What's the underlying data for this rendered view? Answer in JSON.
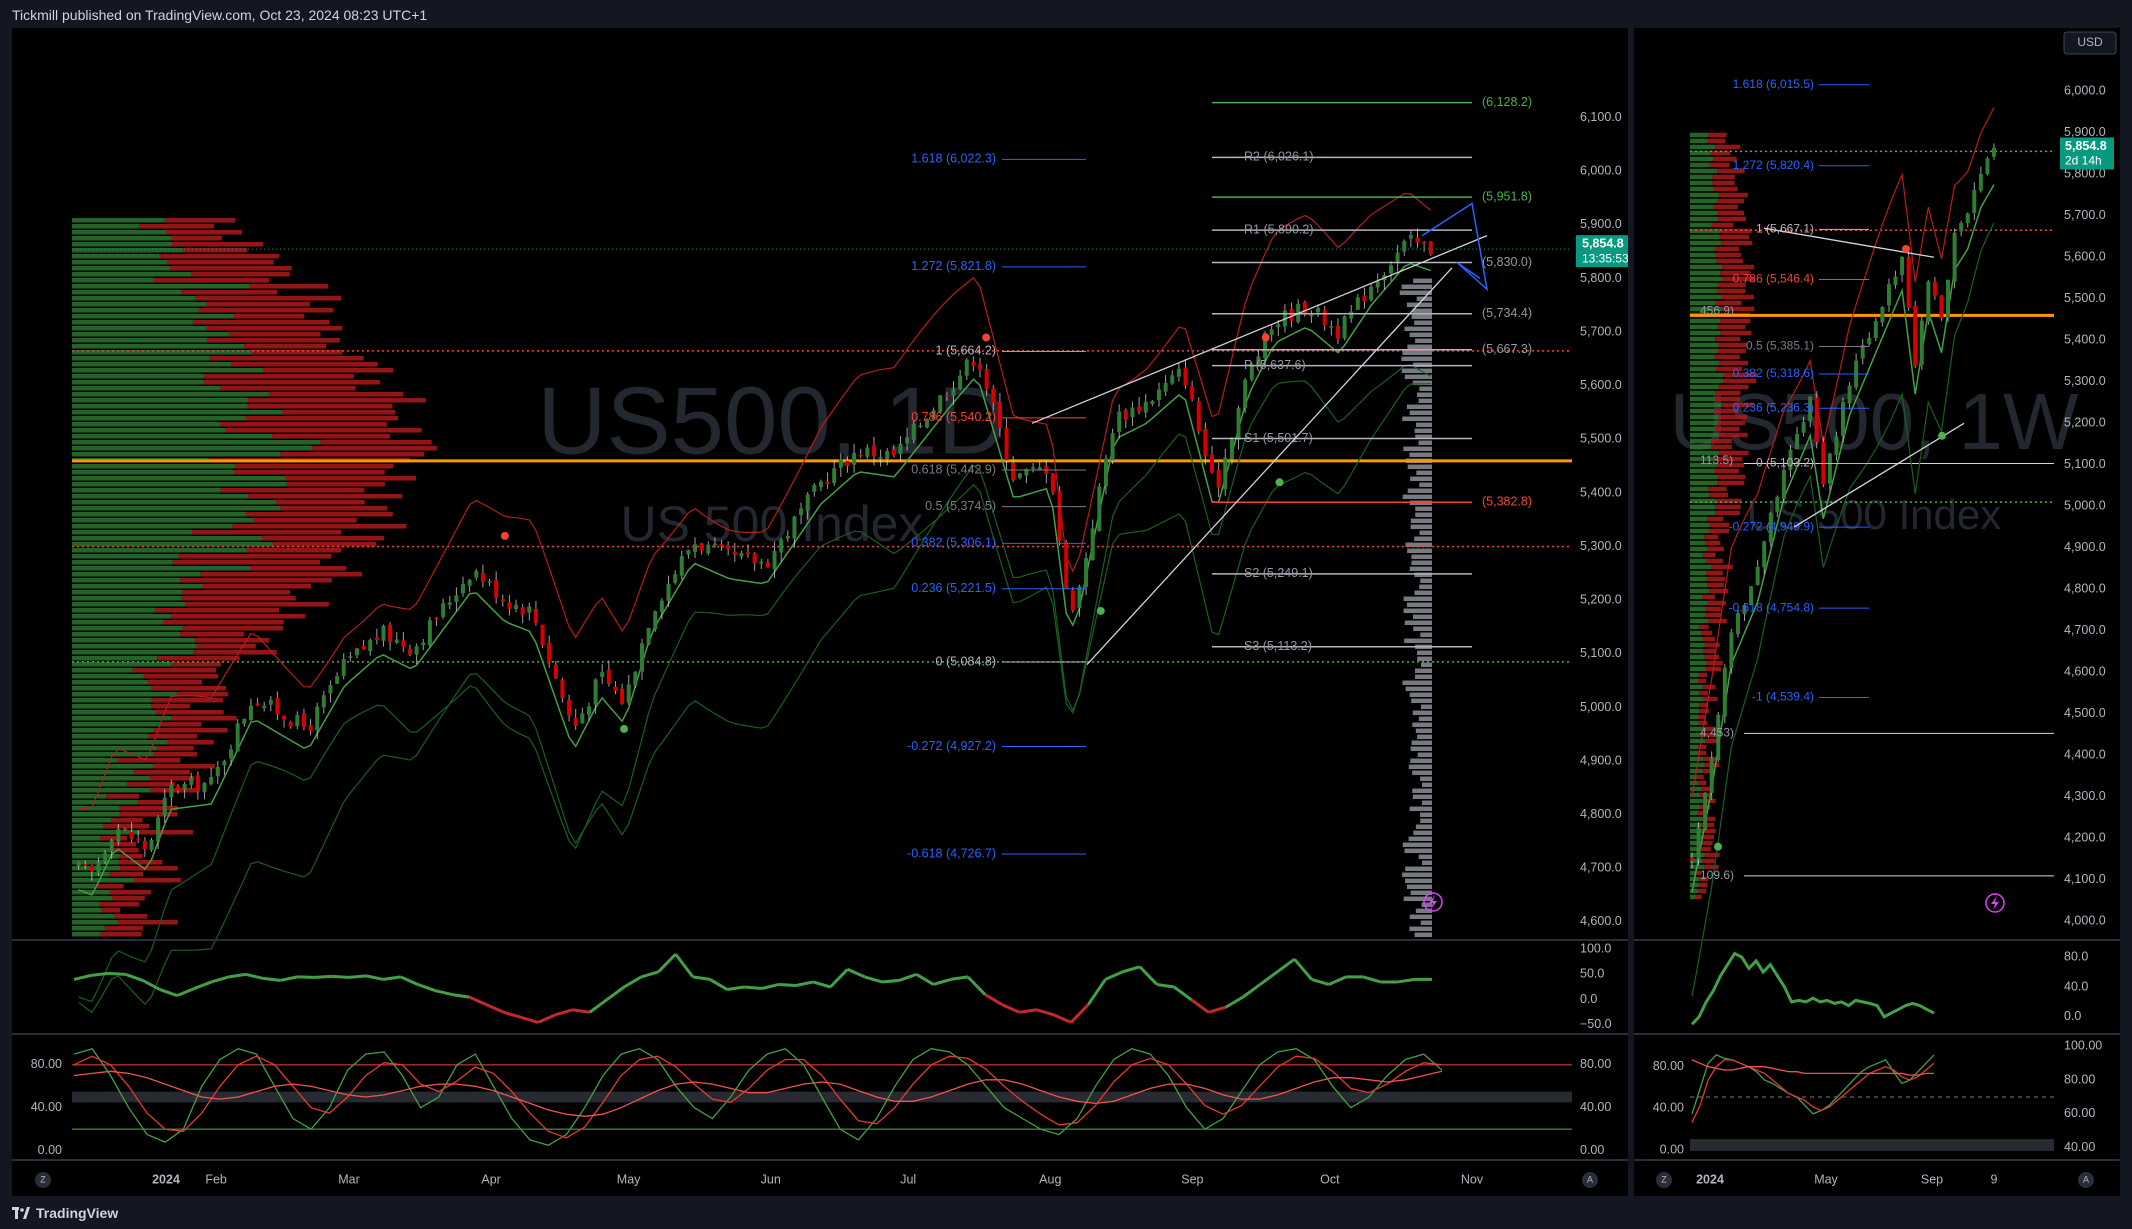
{
  "header": {
    "published": "Tickmill published on TradingView.com, Oct 23, 2024 08:23 UTC+1"
  },
  "footer": {
    "brand": "TradingView"
  },
  "colors": {
    "up": "#2e7d32",
    "down": "#d50000",
    "fib": "#2962ff",
    "pivot": "#b2b5be",
    "orange": "#ff9800",
    "green_level": "#4caf50",
    "price_tag": "#089981"
  },
  "icons": [
    "lightning-icon",
    "go-to-start-icon",
    "auto-scale-icon",
    "tradingview-logo-icon"
  ],
  "chart_data": [
    {
      "type": "candlestick",
      "symbol_watermark": "US500, 1D",
      "subtitle_watermark": "US 500 Index",
      "timeframe": "1D",
      "x_labels": [
        "2024",
        "Feb",
        "Mar",
        "Apr",
        "May",
        "Jun",
        "Jul",
        "Aug",
        "Sep",
        "Oct",
        "Nov"
      ],
      "y_ticks": [
        "6,100.0",
        "6,000.0",
        "5,900.0",
        "5,800.0",
        "5,700.0",
        "5,600.0",
        "5,500.0",
        "5,400.0",
        "5,300.0",
        "5,200.0",
        "5,100.0",
        "5,000.0",
        "4,900.0",
        "4,800.0",
        "4,700.0",
        "4,600.0"
      ],
      "ylim": [
        4570,
        6230
      ],
      "last_price": "5,854.8",
      "countdown": "13:35:53",
      "price_path": [
        [
          "2024-01-02",
          4700
        ],
        [
          "2024-01-05",
          4690
        ],
        [
          "2024-01-10",
          4780
        ],
        [
          "2024-01-17",
          4735
        ],
        [
          "2024-01-22",
          4850
        ],
        [
          "2024-01-31",
          4860
        ],
        [
          "2024-02-09",
          5020
        ],
        [
          "2024-02-21",
          4960
        ],
        [
          "2024-02-29",
          5080
        ],
        [
          "2024-03-08",
          5140
        ],
        [
          "2024-03-15",
          5110
        ],
        [
          "2024-03-28",
          5260
        ],
        [
          "2024-04-04",
          5200
        ],
        [
          "2024-04-10",
          5180
        ],
        [
          "2024-04-19",
          4960
        ],
        [
          "2024-04-25",
          5060
        ],
        [
          "2024-04-30",
          5010
        ],
        [
          "2024-05-06",
          5180
        ],
        [
          "2024-05-15",
          5310
        ],
        [
          "2024-05-23",
          5280
        ],
        [
          "2024-05-31",
          5270
        ],
        [
          "2024-06-12",
          5420
        ],
        [
          "2024-06-20",
          5480
        ],
        [
          "2024-06-28",
          5470
        ],
        [
          "2024-07-10",
          5600
        ],
        [
          "2024-07-16",
          5660
        ],
        [
          "2024-07-24",
          5430
        ],
        [
          "2024-08-01",
          5450
        ],
        [
          "2024-08-05",
          5180
        ],
        [
          "2024-08-07",
          5210
        ],
        [
          "2024-08-15",
          5540
        ],
        [
          "2024-08-22",
          5570
        ],
        [
          "2024-08-30",
          5630
        ],
        [
          "2024-09-06",
          5400
        ],
        [
          "2024-09-13",
          5620
        ],
        [
          "2024-09-19",
          5720
        ],
        [
          "2024-09-26",
          5750
        ],
        [
          "2024-10-03",
          5700
        ],
        [
          "2024-10-10",
          5790
        ],
        [
          "2024-10-18",
          5870
        ],
        [
          "2024-10-23",
          5854.8
        ]
      ],
      "levels": [
        {
          "label": "(6,128.2)",
          "value": 6128.2,
          "kind": "green"
        },
        {
          "label": "R2 (6,026.1)",
          "value": 6026.1,
          "kind": "pivot"
        },
        {
          "label": "(5,951.8)",
          "value": 5951.8,
          "kind": "green"
        },
        {
          "label": "R1 (5,890.2)",
          "value": 5890.2,
          "kind": "pivot"
        },
        {
          "label": "(5,830.0)",
          "value": 5830.0,
          "kind": "pivot"
        },
        {
          "label": "(5,734.4)",
          "value": 5734.4,
          "kind": "pivot"
        },
        {
          "label": "(5,667.3)",
          "value": 5667.3,
          "kind": "pivot"
        },
        {
          "label": "P (5,637.6)",
          "value": 5637.6,
          "kind": "pivot"
        },
        {
          "label": "S1 (5,501.7)",
          "value": 5501.7,
          "kind": "pivot"
        },
        {
          "label": "(5,382.8)",
          "value": 5382.8,
          "kind": "red"
        },
        {
          "label": "S2 (5,249.1)",
          "value": 5249.1,
          "kind": "pivot"
        },
        {
          "label": "S3 (5,113.2)",
          "value": 5113.2,
          "kind": "pivot"
        }
      ],
      "fib_levels": [
        {
          "label": "1.618 (6,022.3)",
          "value": 6022.3,
          "color": "#2962ff"
        },
        {
          "label": "1.272 (5,821.8)",
          "value": 5821.8,
          "color": "#2962ff"
        },
        {
          "label": "1 (5,664.2)",
          "value": 5664.2,
          "color": "#b2b5be"
        },
        {
          "label": "0.786 (5,540.2)",
          "value": 5540.2,
          "color": "#f44336"
        },
        {
          "label": "0.618 (5,442.9)",
          "value": 5442.9,
          "color": "#787b86"
        },
        {
          "label": "0.5 (5,374.5)",
          "value": 5374.5,
          "color": "#787b86"
        },
        {
          "label": "0.382 (5,306.1)",
          "value": 5306.1,
          "color": "#2962ff"
        },
        {
          "label": "0.236 (5,221.5)",
          "value": 5221.5,
          "color": "#2962ff"
        },
        {
          "label": "0 (5,084.8)",
          "value": 5084.8,
          "color": "#b2b5be"
        },
        {
          "label": "-0.272 (4,927.2)",
          "value": 4927.2,
          "color": "#2962ff"
        },
        {
          "label": "-0.618 (4,726.7)",
          "value": 4726.7,
          "color": "#2962ff"
        }
      ],
      "horizontal_lines": [
        {
          "value": 5460,
          "color": "#ff9800",
          "style": "solid"
        },
        {
          "value": 5665,
          "color": "#f44336",
          "style": "dotted"
        },
        {
          "value": 5085,
          "color": "#4caf50",
          "style": "dotted"
        },
        {
          "value": 5300,
          "color": "#f44336",
          "style": "dotted"
        }
      ],
      "oscillator_1": {
        "y_ticks": [
          "100.0",
          "50.0",
          "0.0",
          "−50.0"
        ],
        "ylim": [
          -60,
          110
        ],
        "values": [
          40,
          48,
          52,
          50,
          38,
          20,
          8,
          22,
          35,
          45,
          50,
          42,
          38,
          45,
          44,
          46,
          44,
          47,
          40,
          45,
          30,
          18,
          10,
          5,
          -10,
          -25,
          -35,
          -45,
          -30,
          -20,
          -25,
          0,
          25,
          45,
          55,
          90,
          45,
          40,
          20,
          25,
          22,
          30,
          28,
          35,
          25,
          60,
          45,
          35,
          38,
          50,
          30,
          40,
          45,
          10,
          -10,
          -25,
          -20,
          -30,
          -45,
          -10,
          40,
          55,
          65,
          30,
          25,
          0,
          -25,
          -15,
          5,
          30,
          55,
          80,
          40,
          30,
          45,
          45,
          35,
          35,
          40,
          40
        ]
      },
      "oscillator_2": {
        "y_ticks": [
          "80.00",
          "40.00",
          "0.00"
        ],
        "ylim": [
          -5,
          105
        ],
        "series_a": [
          90,
          95,
          70,
          40,
          15,
          8,
          20,
          60,
          85,
          95,
          90,
          60,
          30,
          20,
          40,
          75,
          90,
          92,
          70,
          40,
          50,
          80,
          90,
          60,
          30,
          10,
          5,
          15,
          40,
          70,
          90,
          95,
          85,
          60,
          40,
          30,
          50,
          75,
          90,
          95,
          80,
          50,
          20,
          10,
          30,
          60,
          85,
          95,
          92,
          80,
          60,
          40,
          30,
          20,
          15,
          30,
          60,
          85,
          95,
          90,
          70,
          40,
          20,
          30,
          55,
          80,
          92,
          95,
          85,
          60,
          40,
          50,
          70,
          85,
          90,
          75
        ],
        "series_b": [
          80,
          88,
          80,
          60,
          35,
          20,
          18,
          35,
          60,
          80,
          88,
          80,
          60,
          40,
          35,
          50,
          70,
          82,
          80,
          62,
          55,
          65,
          78,
          72,
          55,
          35,
          18,
          12,
          22,
          45,
          70,
          85,
          88,
          78,
          62,
          48,
          45,
          58,
          75,
          85,
          85,
          70,
          48,
          28,
          25,
          40,
          62,
          80,
          88,
          86,
          76,
          60,
          46,
          34,
          24,
          26,
          42,
          64,
          80,
          86,
          80,
          62,
          42,
          34,
          42,
          60,
          78,
          88,
          86,
          74,
          58,
          54,
          62,
          74,
          82,
          80
        ],
        "series_c": [
          70,
          72,
          74,
          72,
          68,
          62,
          56,
          50,
          48,
          50,
          55,
          60,
          62,
          60,
          56,
          52,
          50,
          52,
          56,
          60,
          62,
          62,
          60,
          56,
          50,
          44,
          38,
          34,
          32,
          34,
          40,
          48,
          56,
          62,
          64,
          62,
          58,
          54,
          54,
          58,
          62,
          64,
          62,
          56,
          50,
          46,
          46,
          50,
          56,
          62,
          66,
          66,
          62,
          56,
          50,
          46,
          44,
          46,
          52,
          58,
          62,
          62,
          58,
          52,
          48,
          48,
          52,
          58,
          64,
          68,
          68,
          66,
          64,
          66,
          70,
          74
        ]
      }
    },
    {
      "type": "candlestick",
      "symbol_watermark": "US500, 1W",
      "subtitle_watermark": "US 500 Index",
      "timeframe": "1W",
      "currency": "USD",
      "x_labels": [
        "2024",
        "May",
        "Sep",
        "9"
      ],
      "y_ticks": [
        "6,000.0",
        "5,900.0",
        "5,800.0",
        "5,700.0",
        "5,600.0",
        "5,500.0",
        "5,400.0",
        "5,300.0",
        "5,200.0",
        "5,100.0",
        "5,000.0",
        "4,900.0",
        "4,800.0",
        "4,700.0",
        "4,600.0",
        "4,500.0",
        "4,400.0",
        "4,300.0",
        "4,200.0",
        "4,100.0",
        "4,000.0"
      ],
      "ylim": [
        3960,
        6080
      ],
      "last_price": "5,854.8",
      "countdown": "2d 14h",
      "price_path": [
        [
          0,
          4150
        ],
        [
          3,
          4400
        ],
        [
          6,
          4700
        ],
        [
          10,
          4850
        ],
        [
          14,
          5100
        ],
        [
          18,
          5250
        ],
        [
          20,
          5050
        ],
        [
          24,
          5300
        ],
        [
          28,
          5450
        ],
        [
          32,
          5600
        ],
        [
          34,
          5350
        ],
        [
          36,
          5550
        ],
        [
          38,
          5450
        ],
        [
          40,
          5650
        ],
        [
          42,
          5700
        ],
        [
          44,
          5800
        ],
        [
          46,
          5855
        ]
      ],
      "fib_levels": [
        {
          "label": "1.618 (6,015.5)",
          "value": 6015.5,
          "color": "#2962ff"
        },
        {
          "label": "1.272 (5,820.4)",
          "value": 5820.4,
          "color": "#2962ff"
        },
        {
          "label": "1 (5,667.1)",
          "value": 5667.1,
          "color": "#b2b5be"
        },
        {
          "label": "0.786 (5,546.4)",
          "value": 5546.4,
          "color": "#f44336"
        },
        {
          "label": "0.5 (5,385.1)",
          "value": 5385.1,
          "color": "#787b86"
        },
        {
          "label": "0.382 (5,318.6)",
          "value": 5318.6,
          "color": "#2962ff"
        },
        {
          "label": "0.236 (5,236.3)",
          "value": 5236.3,
          "color": "#2962ff"
        },
        {
          "label": "0 (5,103.2)",
          "value": 5103.2,
          "color": "#b2b5be"
        },
        {
          "label": "-0.272 (4,949.9)",
          "value": 4949.9,
          "color": "#2962ff"
        },
        {
          "label": "-0.618 (4,754.8)",
          "value": 4754.8,
          "color": "#2962ff"
        },
        {
          "label": "-1 (4,539.4)",
          "value": 4539.4,
          "color": "#2962ff"
        }
      ],
      "side_labels": [
        {
          "label": "456.9)",
          "value": 5470
        },
        {
          "label": "113.5)",
          "value": 5110
        },
        {
          "label": "4,453)",
          "value": 4453
        },
        {
          "label": "109.6)",
          "value": 4109.6
        }
      ],
      "horizontal_lines": [
        {
          "value": 5460,
          "color": "#ff9800",
          "style": "solid"
        },
        {
          "value": 5665,
          "color": "#f44336",
          "style": "dotted"
        },
        {
          "value": 5010,
          "color": "#4caf50",
          "style": "dotted"
        },
        {
          "value": 5855,
          "color": "#4caf50",
          "style": "dotted"
        }
      ],
      "oscillator_1": {
        "y_ticks": [
          "80.0",
          "40.0",
          "0.0"
        ],
        "ylim": [
          -15,
          95
        ],
        "values": [
          -10,
          0,
          20,
          35,
          55,
          70,
          85,
          80,
          65,
          75,
          60,
          70,
          55,
          40,
          20,
          22,
          20,
          25,
          20,
          22,
          18,
          20,
          15,
          22,
          20,
          18,
          15,
          0,
          5,
          10,
          15,
          18,
          15,
          10,
          5
        ]
      },
      "oscillator_2": {
        "y_ticks": [
          "100.00",
          "80.00",
          "60.00",
          "40.00"
        ],
        "left_ticks": [
          "80.00",
          "40.00",
          "0.00"
        ],
        "ylim": [
          35,
          105
        ],
        "series_a": [
          60,
          75,
          90,
          95,
          93,
          92,
          90,
          88,
          85,
          80,
          78,
          75,
          72,
          70,
          65,
          60,
          62,
          65,
          70,
          75,
          80,
          85,
          88,
          90,
          92,
          85,
          78,
          80,
          85,
          90,
          95
        ],
        "series_b": [
          55,
          65,
          80,
          88,
          92,
          92,
          90,
          88,
          86,
          84,
          80,
          76,
          72,
          70,
          68,
          64,
          62,
          64,
          68,
          72,
          76,
          80,
          84,
          86,
          88,
          86,
          82,
          80,
          82,
          86,
          90
        ],
        "series_c": [
          92,
          90,
          88,
          87,
          86,
          86,
          87,
          88,
          88,
          88,
          87,
          86,
          85,
          85,
          84,
          84,
          84,
          84,
          84,
          84,
          84,
          84,
          84,
          84,
          84,
          84,
          84,
          83,
          83,
          84,
          84
        ]
      }
    }
  ]
}
